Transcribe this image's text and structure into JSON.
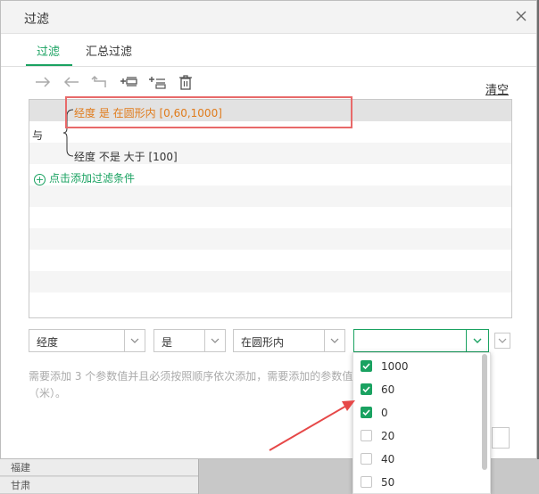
{
  "dialog": {
    "title": "过滤"
  },
  "tabs": [
    {
      "label": "过滤",
      "active": true
    },
    {
      "label": "汇总过滤",
      "active": false
    }
  ],
  "toolbar": {
    "icons": [
      "arrow-right-icon",
      "arrow-left-icon",
      "undo-icon",
      "insert-condition-icon",
      "add-condition-icon",
      "delete-icon"
    ],
    "clear_label": "清空"
  },
  "rules": {
    "connector": "与",
    "conditions": [
      {
        "text": "经度 是 在圆形内 [0,60,1000]",
        "selected": true
      },
      {
        "text": "经度 不是 大于 [100]",
        "selected": false
      }
    ],
    "add_label": "点击添加过滤条件"
  },
  "editor": {
    "field": "经度",
    "operator": "是",
    "condition": "在圆形内",
    "value": ""
  },
  "hint": "需要添加 3 个参数值并且必须按照顺序依次添加，需要添加的参数值（米）。",
  "dropdown": {
    "options": [
      {
        "label": "1000",
        "checked": true
      },
      {
        "label": "60",
        "checked": true
      },
      {
        "label": "0",
        "checked": true
      },
      {
        "label": "20",
        "checked": false
      },
      {
        "label": "40",
        "checked": false
      },
      {
        "label": "50",
        "checked": false
      }
    ]
  },
  "background_rows": [
    "福建",
    "甘肃"
  ],
  "colors": {
    "accent": "#1aa261",
    "condition_selected": "#e07b1b",
    "annotation": "#e86a6a"
  }
}
